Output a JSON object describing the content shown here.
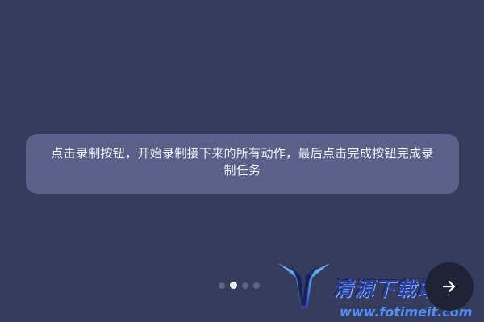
{
  "tip": {
    "text": "点击录制按钮，开始录制接下来的所有动作，最后点击完成按钮完成录制任务"
  },
  "pager": {
    "total": 4,
    "current": 2
  },
  "next_button": {
    "icon": "arrow-right-icon"
  },
  "watermark": {
    "logo_text": "清源下载站",
    "url": "www.fotimeit.com"
  },
  "colors": {
    "background": "#363c5e",
    "card": "#5a6088",
    "dot_active": "#f2f3f8",
    "dot_inactive": "#5d6384",
    "next_button": "#1f2336"
  }
}
